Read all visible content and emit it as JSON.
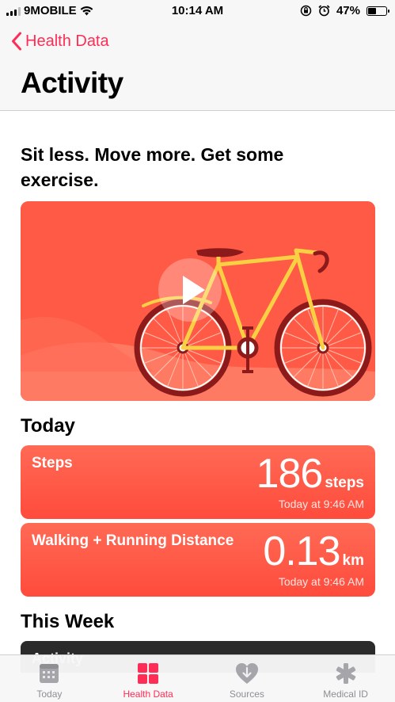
{
  "status_bar": {
    "carrier": "9MOBILE",
    "time": "10:14 AM",
    "battery_percent_label": "47%",
    "battery_level": 0.47
  },
  "header": {
    "back_label": "Health Data",
    "title": "Activity"
  },
  "headline": "Sit less. Move more. Get some exercise.",
  "today_section": {
    "title": "Today",
    "metrics": [
      {
        "label": "Steps",
        "value": "186",
        "unit": "steps",
        "time": "Today at 9:46 AM"
      },
      {
        "label": "Walking + Running Distance",
        "value": "0.13",
        "unit": "km",
        "time": "Today at 9:46 AM"
      }
    ]
  },
  "week_section": {
    "title": "This Week",
    "card_label": "Activity"
  },
  "tab_bar": {
    "tabs": [
      {
        "label": "Today",
        "icon": "calendar-icon"
      },
      {
        "label": "Health Data",
        "icon": "grid-icon"
      },
      {
        "label": "Sources",
        "icon": "heart-download-icon"
      },
      {
        "label": "Medical ID",
        "icon": "asterisk-icon"
      }
    ],
    "active_tab": "Health Data"
  },
  "colors": {
    "accent": "#ff2d55",
    "card_red": "#ff5a45",
    "bike_yellow": "#f9d044",
    "bike_dark": "#8c1a1a"
  }
}
